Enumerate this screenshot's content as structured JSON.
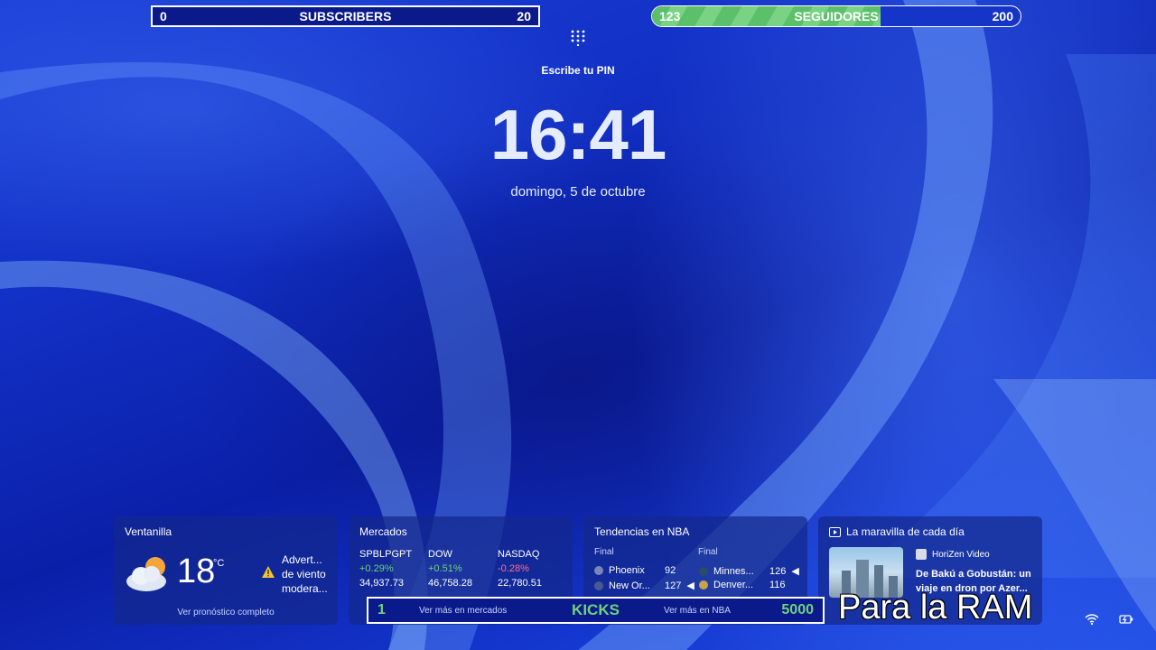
{
  "subscribers_bar": {
    "left": "0",
    "label": "SUBSCRIBERS",
    "right": "20"
  },
  "followers_bar": {
    "left": "123",
    "label": "SEGUIDORES",
    "right": "200",
    "progress": 0.62
  },
  "lock": {
    "pin_prompt": "Escribe tu PIN",
    "time": "16:41",
    "date": "domingo, 5 de octubre"
  },
  "weather": {
    "title": "Ventanilla",
    "temp": "18",
    "unit": "°C",
    "alert_lines": [
      "Advert...",
      "de viento",
      "modera..."
    ],
    "link": "Ver pronóstico completo",
    "icon": "partly-cloudy-icon"
  },
  "markets": {
    "title": "Mercados",
    "items": [
      {
        "name": "SPBLPGPT",
        "change": "+0.29%",
        "value": "34,937.73",
        "trend": "up"
      },
      {
        "name": "DOW",
        "change": "+0.51%",
        "value": "46,758.28",
        "trend": "up"
      },
      {
        "name": "NASDAQ",
        "change": "-0.28%",
        "value": "22,780.51",
        "trend": "down"
      }
    ],
    "link": "Ver más en mercados"
  },
  "nba": {
    "title": "Tendencias en NBA",
    "games": [
      {
        "status": "Final",
        "team1": "Phoenix",
        "score1": "92",
        "team2": "New Or...",
        "score2": "127"
      },
      {
        "status": "Final",
        "team1": "Minnes...",
        "score1": "126",
        "team2": "Denver...",
        "score2": "116"
      }
    ],
    "link": "Ver más en NBA"
  },
  "daily": {
    "title": "La maravilla de cada día",
    "source": "HoriZen Video",
    "headline_lines": [
      "De Bakú a Gobustán: un",
      "viaje en dron por Azer..."
    ]
  },
  "kicks_bar": {
    "left": "1",
    "label": "KICKS",
    "right": "5000"
  },
  "overlay_text": "Para la RAM",
  "colors": {
    "accent_green": "#6fd37c",
    "down_red": "#ff6f8a",
    "panel": "#0b1a8a"
  }
}
